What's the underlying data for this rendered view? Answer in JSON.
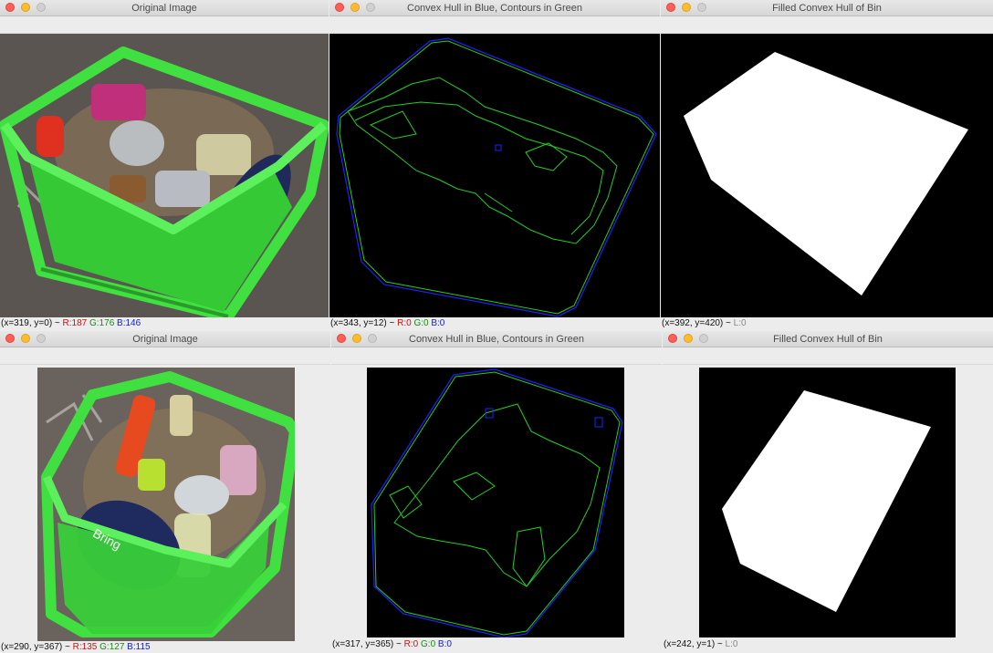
{
  "windows": [
    {
      "title": "Original Image",
      "status": {
        "coord": "(x=319, y=0) ~",
        "r": "R:187",
        "g": "G:176",
        "b": "B:146"
      }
    },
    {
      "title": "Convex Hull in Blue, Contours in Green",
      "status": {
        "coord": "(x=343, y=12) ~",
        "r": "R:0",
        "g": "G:0",
        "b": "B:0"
      }
    },
    {
      "title": "Filled Convex Hull of Bin",
      "status": {
        "coord": "(x=392, y=420) ~",
        "l": "L:0"
      }
    },
    {
      "title": "Original Image",
      "status": {
        "coord": "(x=290, y=367) ~",
        "r": "R:135",
        "g": "G:127",
        "b": "B:115"
      },
      "image_text": "Bring"
    },
    {
      "title": "Convex Hull in Blue, Contours in Green",
      "status": {
        "coord": "(x=317, y=365) ~",
        "r": "R:0",
        "g": "G:0",
        "b": "B:0"
      }
    },
    {
      "title": "Filled Convex Hull of Bin",
      "status": {
        "coord": "(x=242, y=1) ~",
        "l": "L:0"
      }
    }
  ],
  "colors": {
    "hull_blue": "#2020ff",
    "contour_green": "#20d020",
    "bin_green": "#3cd13c",
    "carpet": "#5a5450",
    "mask_white": "#ffffff",
    "mask_black": "#000000"
  }
}
